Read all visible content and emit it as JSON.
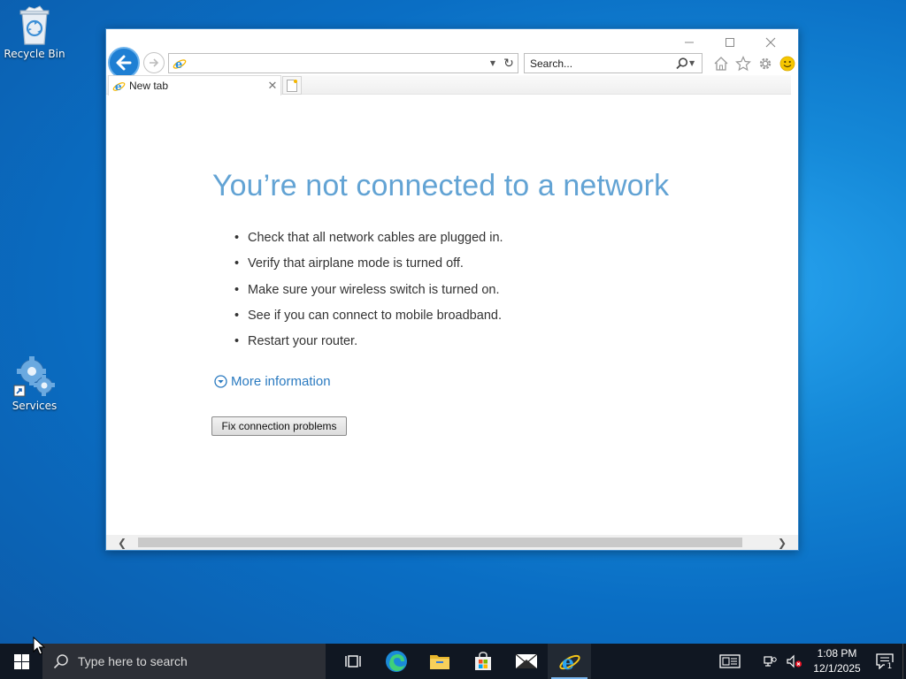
{
  "desktop": {
    "icons": [
      {
        "label": "Recycle Bin",
        "icon": "recycle-bin-icon"
      },
      {
        "label": "Services",
        "icon": "services-gear-icon"
      }
    ]
  },
  "browser": {
    "address": {
      "value": "",
      "placeholder": ""
    },
    "search": {
      "placeholder": "Search..."
    },
    "tab": {
      "label": "New tab"
    },
    "error": {
      "title": "You’re not connected to a network",
      "bullets": [
        "Check that all network cables are plugged in.",
        "Verify that airplane mode is turned off.",
        "Make sure your wireless switch is turned on.",
        "See if you can connect to mobile broadband.",
        "Restart your router."
      ],
      "more_info": "More information",
      "fix_button": "Fix connection problems"
    },
    "colors": {
      "title": "#62a3d4",
      "link": "#2a7ac0",
      "back_button": "#1e7fd3"
    }
  },
  "taskbar": {
    "search_placeholder": "Type here to search",
    "apps": [
      "task-view-icon",
      "edge-icon",
      "file-explorer-icon",
      "store-icon",
      "mail-icon",
      "internet-explorer-icon"
    ],
    "clock": {
      "time": "1:08 PM",
      "date": "12/1/2025"
    },
    "notification_count": "1"
  }
}
